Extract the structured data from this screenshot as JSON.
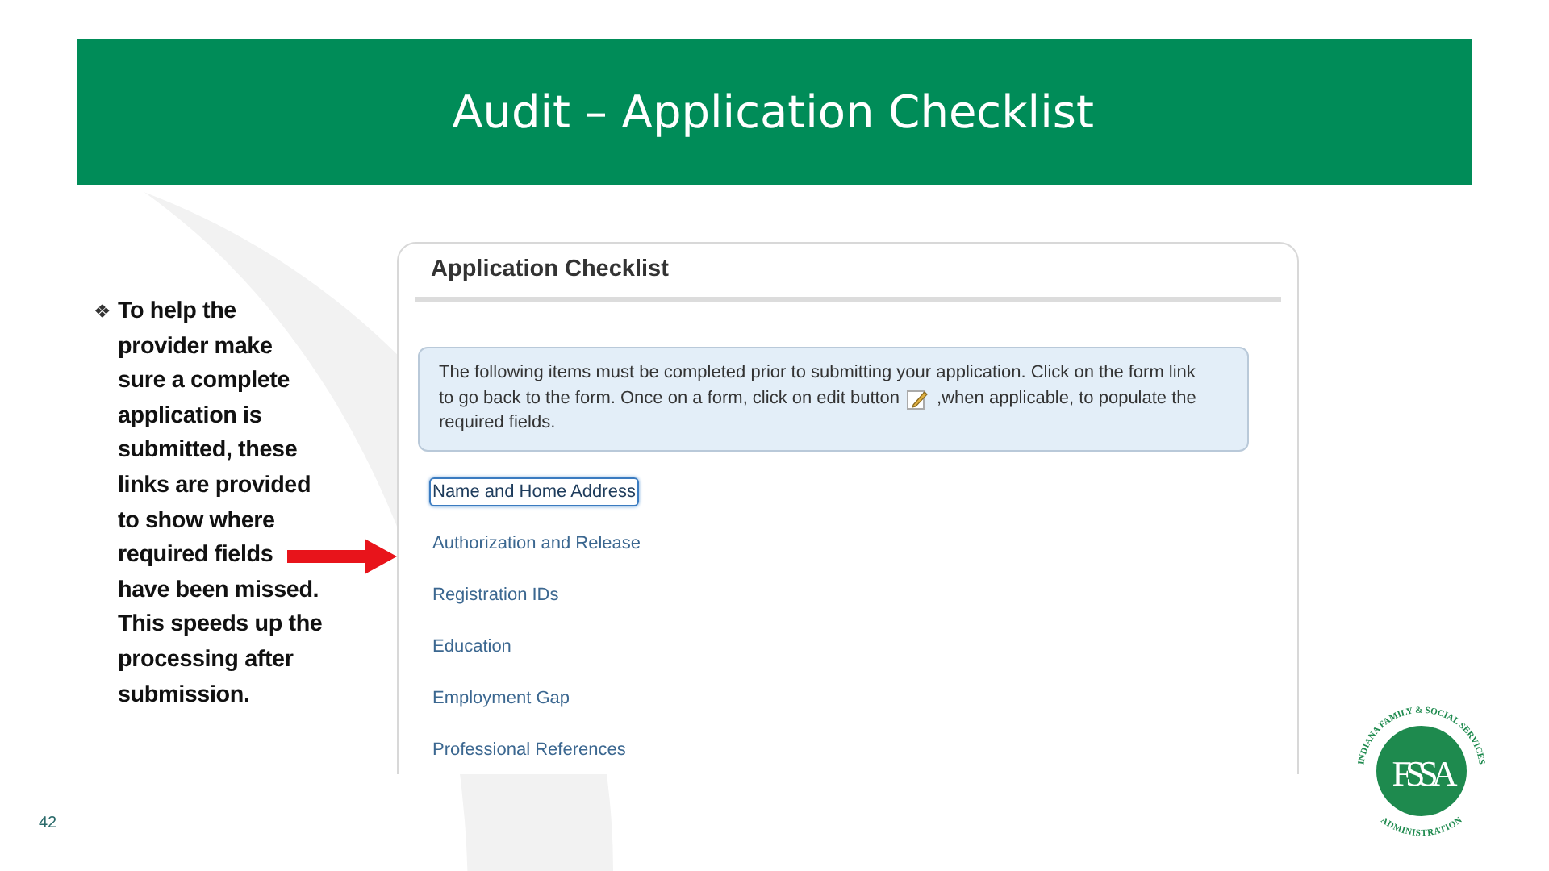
{
  "slide": {
    "title": "Audit – Application Checklist",
    "bullet": "❖",
    "note": "To help the provider make sure a complete application is submitted, these links are provided to show where required fields have been missed. This speeds up the processing after submission.",
    "page_number": "42"
  },
  "panel": {
    "title": "Application Checklist",
    "info_line_1": "The following items must be completed prior to submitting your application. Click on the form link",
    "info_before_icon": "to go back to the form. Once on a form, click on edit button",
    "info_after_icon": ",when applicable, to populate the",
    "info_line_3": "required fields.",
    "links": [
      {
        "label": "Name and Home Address",
        "selected": true
      },
      {
        "label": "Authorization and Release",
        "selected": false
      },
      {
        "label": "Registration IDs",
        "selected": false
      },
      {
        "label": "Education",
        "selected": false
      },
      {
        "label": "Employment Gap",
        "selected": false
      },
      {
        "label": "Professional References",
        "selected": false
      }
    ]
  },
  "logo": {
    "ring_top": "INDIANA FAMILY & SOCIAL SERVICES",
    "ring_bottom": "ADMINISTRATION",
    "monogram": "FSSA"
  }
}
